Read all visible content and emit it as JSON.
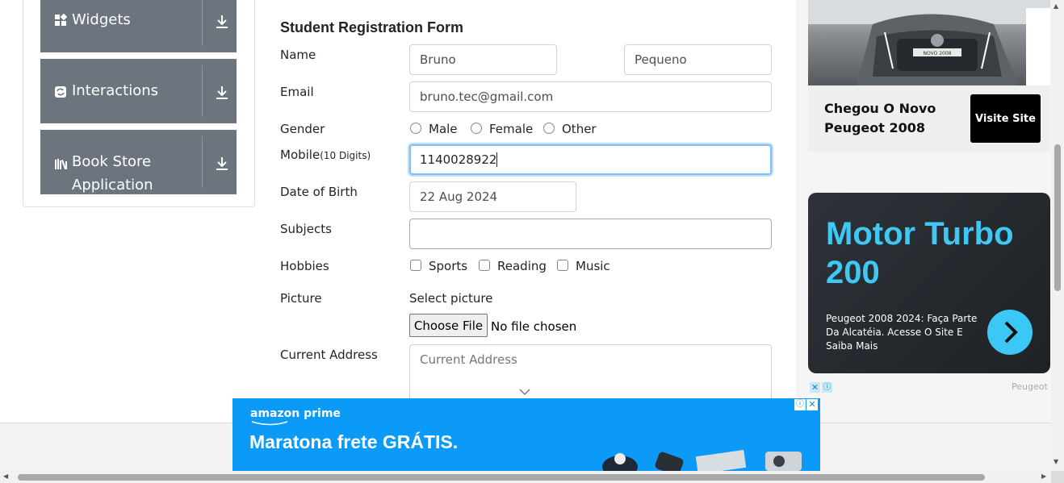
{
  "sidebar": {
    "groups": [
      {
        "label": "Widgets",
        "icon": "widgets-icon"
      },
      {
        "label": "Interactions",
        "icon": "interactions-icon"
      },
      {
        "label": "Book Store",
        "label2": "Application",
        "icon": "book-store-icon"
      }
    ]
  },
  "form": {
    "title": "Student Registration Form",
    "name_label": "Name",
    "first_name": "Bruno",
    "last_name": "Pequeno",
    "email_label": "Email",
    "email": "bruno.tec@gmail.com",
    "gender_label": "Gender",
    "gender_options": [
      "Male",
      "Female",
      "Other"
    ],
    "mobile_label": "Mobile",
    "mobile_hint": "(10 Digits)",
    "mobile": "1140028922",
    "dob_label": "Date of Birth",
    "dob": "22 Aug 2024",
    "subjects_label": "Subjects",
    "subjects": "",
    "hobbies_label": "Hobbies",
    "hobby_options": [
      "Sports",
      "Reading",
      "Music"
    ],
    "picture_label": "Picture",
    "select_picture": "Select picture",
    "choose_file": "Choose File",
    "no_file": "No file chosen",
    "address_label": "Current Address",
    "address_placeholder": "Current Address"
  },
  "ads": {
    "car_title_line1": "Chegou O Novo",
    "car_title_line2": "Peugeot 2008",
    "visit_button": "Visite Site",
    "turbo_title": "Motor Turbo 200",
    "turbo_desc": "Peugeot 2008 2024: Faça Parte Da Alcatéia. Acesse O Site E Saiba Mais",
    "brand_tag": "Peugeot",
    "plate_text": "NOVO 2008",
    "amazon_brand": "amazon prime",
    "amazon_headline": "Maratona frete GRÁTIS.",
    "accent_cyan": "#40c8f4",
    "amazon_blue": "#0b9af7"
  }
}
